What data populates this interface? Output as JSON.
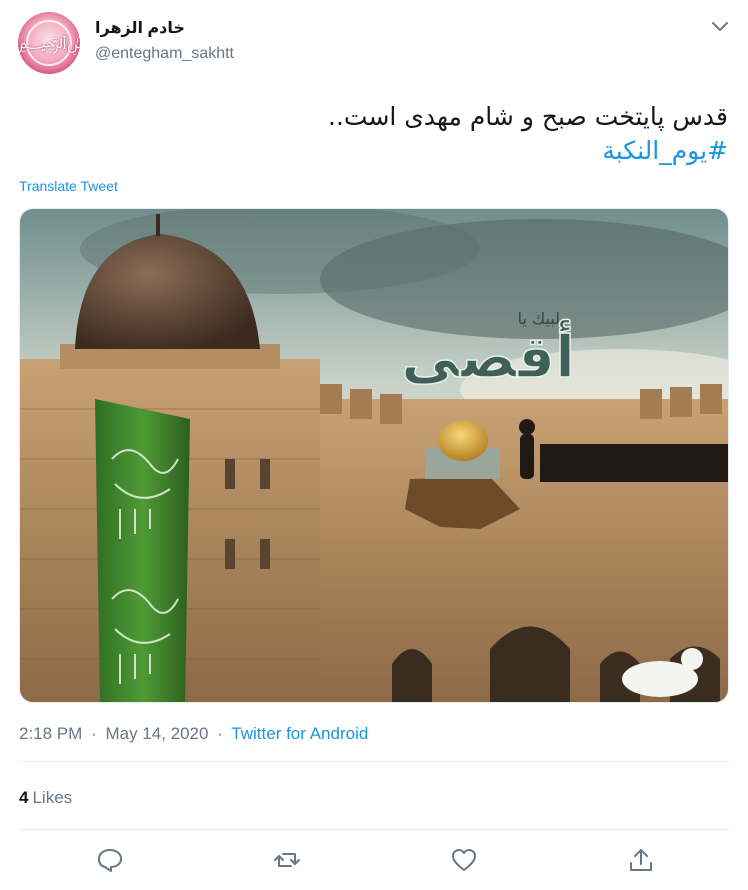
{
  "author": {
    "display_name": "خادم الزهرا",
    "handle": "@entegham_sakhtt"
  },
  "tweet": {
    "text": "قدس پایتخت صبح و شام مهدی است..",
    "hashtag": "#یوم_النکبة",
    "translate_label": "Translate Tweet"
  },
  "media": {
    "title_small": "لبيك يا",
    "title_big": "أقصى"
  },
  "meta": {
    "time": "2:18 PM",
    "date": "May 14, 2020",
    "separator": "·",
    "source": "Twitter for Android"
  },
  "stats": {
    "likes_count": "4",
    "likes_label": "Likes"
  },
  "icons": {
    "more": "chevron-down-icon",
    "reply": "reply-icon",
    "retweet": "retweet-icon",
    "like": "heart-icon",
    "share": "share-icon"
  },
  "colors": {
    "link": "#1b95e0",
    "secondary": "#657786",
    "text": "#14171a",
    "divider": "#e6ecf0"
  }
}
